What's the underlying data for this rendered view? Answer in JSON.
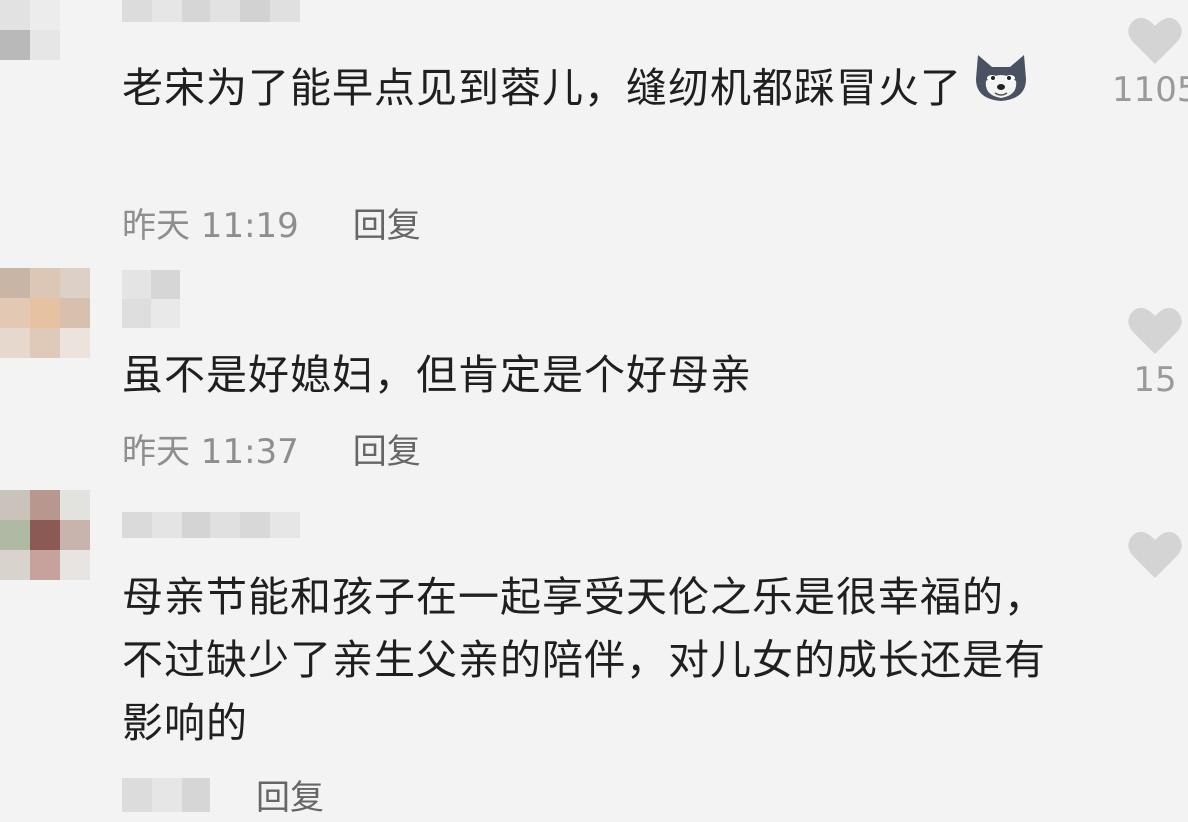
{
  "comments": [
    {
      "text": "老宋为了能早点见到蓉儿，缝纫机都踩冒火了",
      "emoji": "husky-dog-emoji",
      "time": "昨天 11:19",
      "reply_label": "回复",
      "like_count": "1105",
      "like_icon": "heart-icon"
    },
    {
      "text": "虽不是好媳妇，但肯定是个好母亲",
      "time": "昨天 11:37",
      "reply_label": "回复",
      "like_count": "15",
      "like_icon": "heart-icon"
    },
    {
      "text": "母亲节能和孩子在一起享受天伦之乐是很幸福的，不过缺少了亲生父亲的陪伴，对儿女的成长还是有影响的",
      "time": "",
      "reply_label": "回复",
      "like_count": "",
      "like_icon": "heart-icon"
    }
  ],
  "colors": {
    "background": "#f3f3f3",
    "text": "#1f1f1f",
    "meta": "#8e8e8e",
    "heart": "#d4d4d4"
  }
}
